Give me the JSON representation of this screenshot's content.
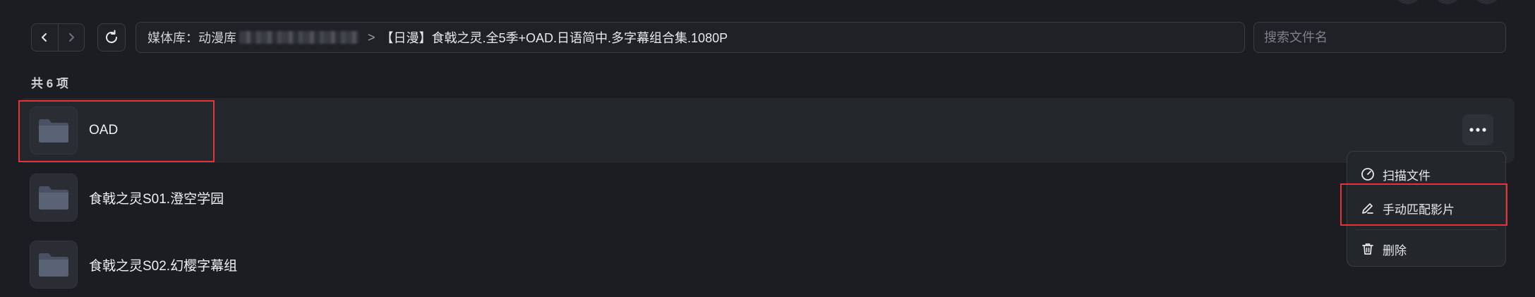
{
  "toolbar": {
    "breadcrumb": {
      "library_label": "媒体库：动漫库",
      "separator": ">",
      "current_folder": "【日漫】食戟之灵.全5季+OAD.日语简中.多字幕组合集.1080P"
    },
    "search": {
      "placeholder": "搜索文件名",
      "value": ""
    }
  },
  "listing": {
    "count_label": "共 6 项",
    "items": [
      {
        "name": "OAD"
      },
      {
        "name": "食戟之灵S01.澄空学园"
      },
      {
        "name": "食戟之灵S02.幻樱字幕组"
      }
    ]
  },
  "context_menu": {
    "items": [
      {
        "label": "扫描文件",
        "icon": "scan-icon"
      },
      {
        "label": "手动匹配影片",
        "icon": "pencil-icon"
      },
      {
        "label": "删除",
        "icon": "trash-icon"
      }
    ]
  },
  "colors": {
    "background": "#1b1d22",
    "highlight": "#e5333a",
    "row_active": "#24272c"
  }
}
